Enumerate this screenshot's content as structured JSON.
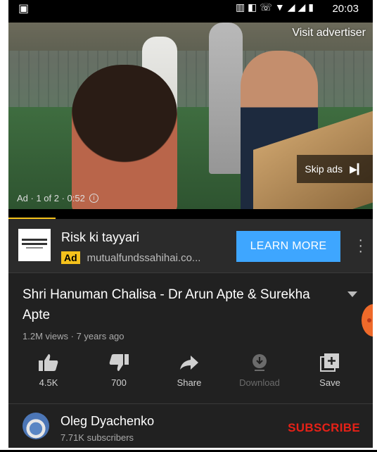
{
  "status_bar": {
    "time": "20:03"
  },
  "player": {
    "visit_advertiser": "Visit advertiser",
    "skip_ads": "Skip ads",
    "ad_info": "Ad · 1 of 2 · 0:52",
    "progress_fraction": 0.13,
    "accent": "#f5c21c"
  },
  "ad": {
    "title": "Risk ki tayyari",
    "badge": "Ad",
    "domain": "mutualfundssahihai.co...",
    "cta": "LEARN MORE",
    "cta_color": "#3ea6ff"
  },
  "video": {
    "title": "Shri Hanuman Chalisa - Dr Arun Apte & Surekha Apte",
    "meta": "1.2M views · 7 years ago"
  },
  "actions": [
    {
      "label": "4.5K",
      "icon": "thumbs-up-icon"
    },
    {
      "label": "700",
      "icon": "thumbs-down-icon"
    },
    {
      "label": "Share",
      "icon": "share-icon"
    },
    {
      "label": "Download",
      "icon": "download-icon"
    },
    {
      "label": "Save",
      "icon": "save-playlist-icon"
    }
  ],
  "channel": {
    "name": "Oleg Dyachenko",
    "subscribers": "7.71K subscribers",
    "subscribe_label": "SUBSCRIBE",
    "subscribe_color": "#e62117"
  }
}
